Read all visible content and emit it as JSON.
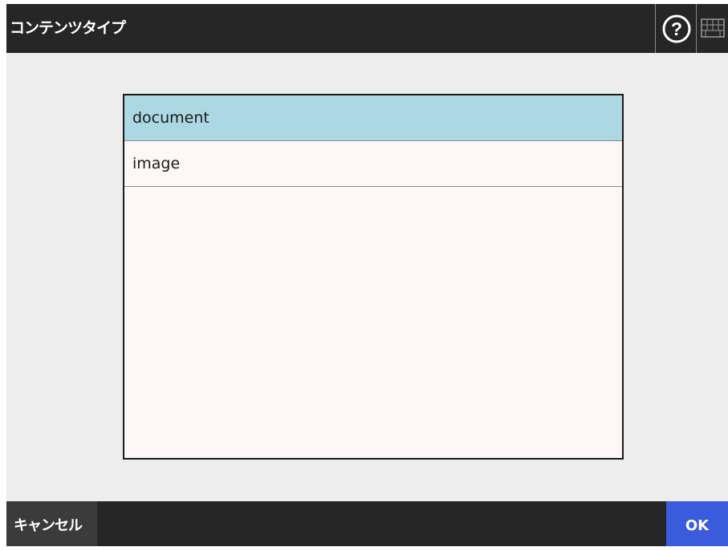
{
  "header": {
    "title": "コンテンツタイプ",
    "help_icon": "help-icon",
    "keyboard_icon": "keyboard-icon"
  },
  "list": {
    "items": [
      {
        "label": "document",
        "selected": true
      },
      {
        "label": "image",
        "selected": false
      }
    ]
  },
  "footer": {
    "cancel_label": "キャンセル",
    "ok_label": "OK"
  },
  "colors": {
    "bar_bg": "#262626",
    "selected_row": "#acd8e4",
    "ok_button": "#3a5bdb",
    "cancel_button": "#3b3b3b"
  }
}
